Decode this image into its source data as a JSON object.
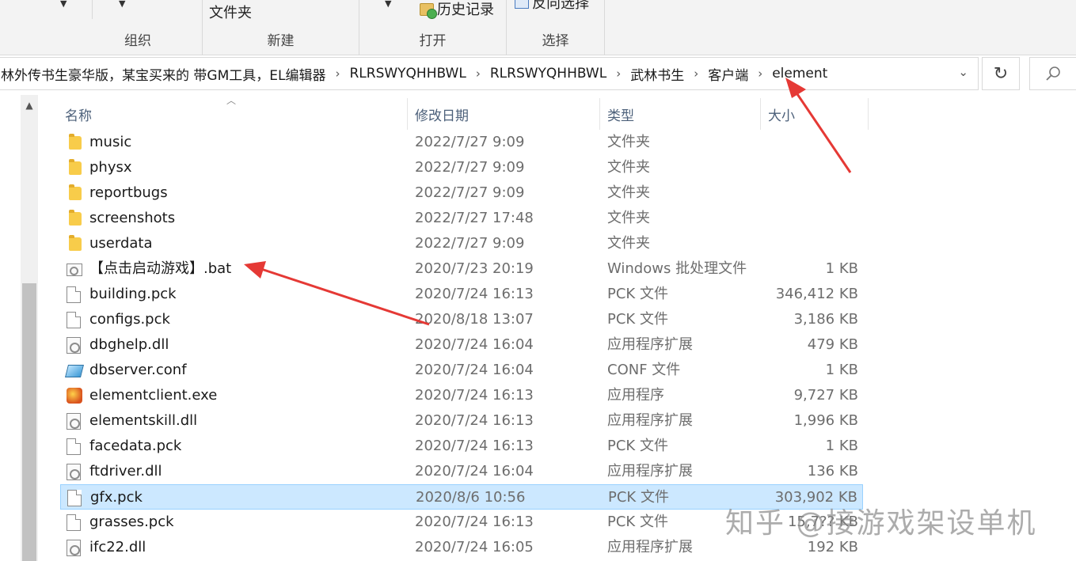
{
  "ribbon": {
    "groups": [
      {
        "label": "组织"
      },
      {
        "label": "新建",
        "button": "文件夹"
      },
      {
        "label": "打开",
        "button": "历史记录"
      },
      {
        "label": "选择",
        "button": "反向选择"
      }
    ]
  },
  "address": {
    "crumbs": [
      "林外传书生豪华版，某宝买来的 带GM工具，EL编辑器",
      "RLRSWYQHHBWL",
      "RLRSWYQHHBWL",
      "武林书生",
      "客户端",
      "element"
    ]
  },
  "columns": {
    "name": "名称",
    "date": "修改日期",
    "type": "类型",
    "size": "大小"
  },
  "files": [
    {
      "name": "music",
      "date": "2022/7/27 9:09",
      "type": "文件夹",
      "size": "",
      "icon": "folder-icon"
    },
    {
      "name": "physx",
      "date": "2022/7/27 9:09",
      "type": "文件夹",
      "size": "",
      "icon": "folder-icon"
    },
    {
      "name": "reportbugs",
      "date": "2022/7/27 9:09",
      "type": "文件夹",
      "size": "",
      "icon": "folder-icon"
    },
    {
      "name": "screenshots",
      "date": "2022/7/27 17:48",
      "type": "文件夹",
      "size": "",
      "icon": "folder-icon"
    },
    {
      "name": "userdata",
      "date": "2022/7/27 9:09",
      "type": "文件夹",
      "size": "",
      "icon": "folder-icon"
    },
    {
      "name": "【点击启动游戏】.bat",
      "date": "2020/7/23 20:19",
      "type": "Windows 批处理文件",
      "size": "1 KB",
      "icon": "batch-file-icon"
    },
    {
      "name": "building.pck",
      "date": "2020/7/24 16:13",
      "type": "PCK 文件",
      "size": "346,412 KB",
      "icon": "file-icon"
    },
    {
      "name": "configs.pck",
      "date": "2020/8/18 13:07",
      "type": "PCK 文件",
      "size": "3,186 KB",
      "icon": "file-icon"
    },
    {
      "name": "dbghelp.dll",
      "date": "2020/7/24 16:04",
      "type": "应用程序扩展",
      "size": "479 KB",
      "icon": "dll-icon"
    },
    {
      "name": "dbserver.conf",
      "date": "2020/7/24 16:04",
      "type": "CONF 文件",
      "size": "1 KB",
      "icon": "conf-icon"
    },
    {
      "name": "elementclient.exe",
      "date": "2020/7/24 16:13",
      "type": "应用程序",
      "size": "9,727 KB",
      "icon": "exe-icon"
    },
    {
      "name": "elementskill.dll",
      "date": "2020/7/24 16:13",
      "type": "应用程序扩展",
      "size": "1,996 KB",
      "icon": "dll-icon"
    },
    {
      "name": "facedata.pck",
      "date": "2020/7/24 16:13",
      "type": "PCK 文件",
      "size": "1 KB",
      "icon": "file-icon"
    },
    {
      "name": "ftdriver.dll",
      "date": "2020/7/24 16:04",
      "type": "应用程序扩展",
      "size": "136 KB",
      "icon": "dll-icon"
    },
    {
      "name": "gfx.pck",
      "date": "2020/8/6 10:56",
      "type": "PCK 文件",
      "size": "303,902 KB",
      "icon": "file-icon",
      "selected": true
    },
    {
      "name": "grasses.pck",
      "date": "2020/7/24 16:13",
      "type": "PCK 文件",
      "size": "15,7?? KB",
      "icon": "file-icon"
    },
    {
      "name": "ifc22.dll",
      "date": "2020/7/24 16:05",
      "type": "应用程序扩展",
      "size": "192 KB",
      "icon": "dll-icon"
    }
  ],
  "watermark": "知乎 @接游戏架设单机",
  "colors": {
    "selection": "#cce8ff",
    "arrow": "#e53935"
  }
}
